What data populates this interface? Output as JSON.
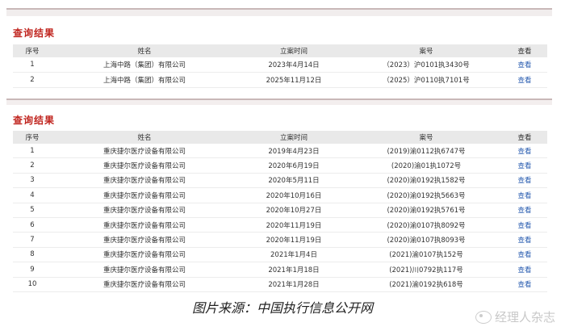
{
  "panel1": {
    "title": "查询结果",
    "headers": {
      "no": "序号",
      "name": "姓名",
      "date": "立案时间",
      "case": "案号",
      "view": "查看"
    },
    "rows": [
      {
        "no": "1",
        "name": "上海中路（集团）有限公司",
        "date": "2023年4月14日",
        "case": "（2023）沪0101执3430号",
        "view": "查看"
      },
      {
        "no": "2",
        "name": "上海中路（集团）有限公司",
        "date": "2025年11月12日",
        "case": "（2025）沪0110执7101号",
        "view": "查看"
      }
    ]
  },
  "panel2": {
    "title": "查询结果",
    "headers": {
      "no": "序号",
      "name": "姓名",
      "date": "立案时间",
      "case": "案号",
      "view": "查看"
    },
    "rows": [
      {
        "no": "1",
        "name": "重庆捷尔医疗设备有限公司",
        "date": "2019年4月23日",
        "case": "(2019)渝0112执6747号",
        "view": "查看"
      },
      {
        "no": "2",
        "name": "重庆捷尔医疗设备有限公司",
        "date": "2020年6月19日",
        "case": "(2020)渝01执1072号",
        "view": "查看"
      },
      {
        "no": "3",
        "name": "重庆捷尔医疗设备有限公司",
        "date": "2020年5月11日",
        "case": "(2020)渝0192执1582号",
        "view": "查看"
      },
      {
        "no": "4",
        "name": "重庆捷尔医疗设备有限公司",
        "date": "2020年10月16日",
        "case": "(2020)渝0192执5663号",
        "view": "查看"
      },
      {
        "no": "5",
        "name": "重庆捷尔医疗设备有限公司",
        "date": "2020年10月27日",
        "case": "(2020)渝0192执5761号",
        "view": "查看"
      },
      {
        "no": "6",
        "name": "重庆捷尔医疗设备有限公司",
        "date": "2020年11月19日",
        "case": "(2020)渝0107执8092号",
        "view": "查看"
      },
      {
        "no": "7",
        "name": "重庆捷尔医疗设备有限公司",
        "date": "2020年11月19日",
        "case": "(2020)渝0107执8093号",
        "view": "查看"
      },
      {
        "no": "8",
        "name": "重庆捷尔医疗设备有限公司",
        "date": "2021年1月4日",
        "case": "(2021)渝0107执152号",
        "view": "查看"
      },
      {
        "no": "9",
        "name": "重庆捷尔医疗设备有限公司",
        "date": "2021年1月18日",
        "case": "(2021)川0792执117号",
        "view": "查看"
      },
      {
        "no": "10",
        "name": "重庆捷尔医疗设备有限公司",
        "date": "2021年1月28日",
        "case": "(2021)渝0192执618号",
        "view": "查看"
      }
    ]
  },
  "caption": "图片来源：中国执行信息公开网",
  "watermark": {
    "text": "经理人杂志",
    "icon": "weibo-icon"
  },
  "colors": {
    "title": "#c0251f",
    "link": "#2a5db0",
    "header_bg": "#e9e9e9"
  }
}
